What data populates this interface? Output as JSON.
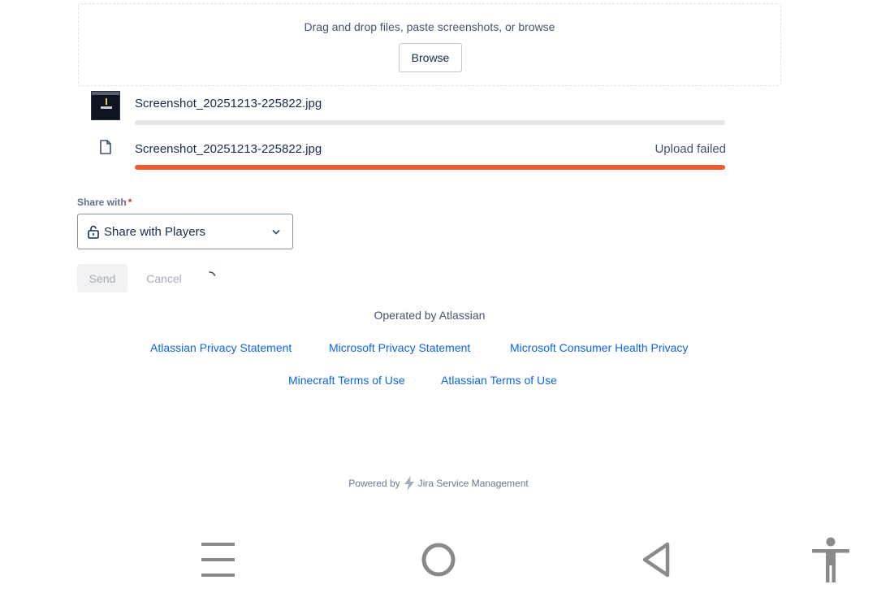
{
  "dropzone": {
    "instruction": "Drag and drop files, paste screenshots, or browse",
    "browse_label": "Browse"
  },
  "files": [
    {
      "name": "Screenshot_20251213-225822.jpg",
      "status": "",
      "progress": 0,
      "icon": "image-thumbnail",
      "bar_color": "#e4e6ea"
    },
    {
      "name": "Screenshot_20251213-225822.jpg",
      "status": "Upload failed",
      "progress": 1.0,
      "icon": "file-icon",
      "bar_color": "#f15b2f"
    }
  ],
  "share": {
    "label": "Share with",
    "required_marker": "*",
    "value": "Share with Players",
    "icon": "unlock-icon"
  },
  "actions": {
    "send_label": "Send",
    "cancel_label": "Cancel"
  },
  "footer": {
    "operated_by": "Operated by Atlassian",
    "links": [
      "Atlassian Privacy Statement",
      "Microsoft Privacy Statement",
      "Microsoft Consumer Health Privacy",
      "Minecraft Terms of Use",
      "Atlassian Terms of Use"
    ],
    "powered_prefix": "Powered by",
    "powered_product": "Jira Service Management"
  },
  "nav_bar": {
    "buttons": [
      "recent-apps-icon",
      "home-icon",
      "back-icon"
    ],
    "accessibility": "accessibility-icon"
  },
  "colors": {
    "link": "#0c66e4",
    "error": "#f15b2f",
    "required": "#de350b"
  }
}
